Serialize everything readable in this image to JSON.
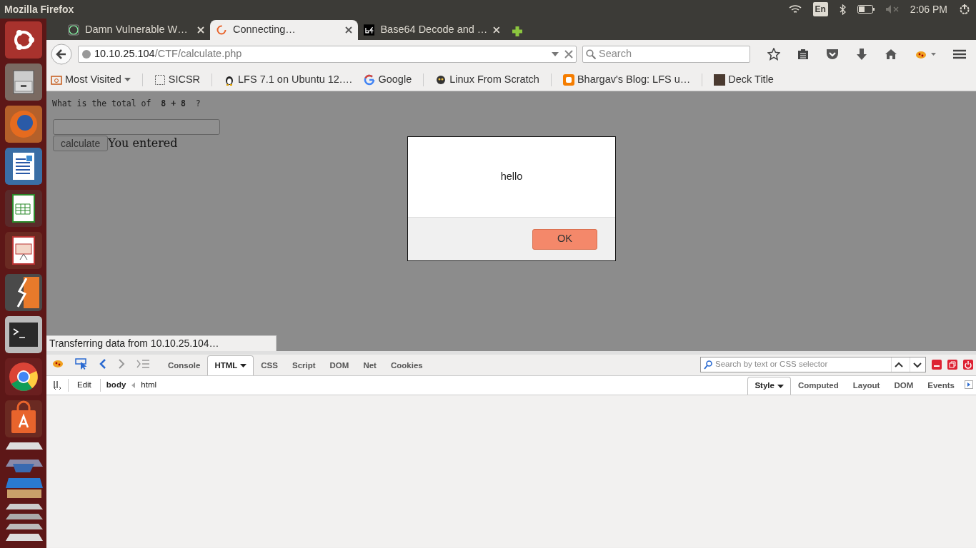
{
  "top_panel": {
    "title": "Mozilla Firefox",
    "keyboard_layout": "En",
    "clock": "2:06 PM"
  },
  "tabs": [
    {
      "label": "Damn Vulnerable W…",
      "selected": false
    },
    {
      "label": "Connecting…",
      "selected": true
    },
    {
      "label": "Base64 Decode and …",
      "selected": false
    }
  ],
  "address": {
    "host": "10.10.25.104",
    "path": "/CTF/calculate.php"
  },
  "search": {
    "placeholder": "Search"
  },
  "bookmarks": [
    {
      "label": "Most Visited",
      "kind": "folder"
    },
    {
      "label": "SICSR",
      "kind": "blank"
    },
    {
      "label": "LFS 7.1 on Ubuntu 12.…",
      "kind": "penguin"
    },
    {
      "label": "Google",
      "kind": "google"
    },
    {
      "label": "Linux From Scratch",
      "kind": "mascot"
    },
    {
      "label": "Bhargav's Blog: LFS u…",
      "kind": "blog"
    },
    {
      "label": "Deck Title",
      "kind": "photo"
    }
  ],
  "page": {
    "question": "What is the total of  **8 + 8**  ?",
    "button": "calculate",
    "result": "You entered"
  },
  "dialog": {
    "message": "hello",
    "button": "OK"
  },
  "status": "Transferring data from 10.10.25.104…",
  "devtools": {
    "panels": [
      {
        "label": "Console",
        "selected": false
      },
      {
        "label": "HTML",
        "selected": true
      },
      {
        "label": "CSS",
        "selected": false
      },
      {
        "label": "Script",
        "selected": false
      },
      {
        "label": "DOM",
        "selected": false
      },
      {
        "label": "Net",
        "selected": false
      },
      {
        "label": "Cookies",
        "selected": false
      }
    ],
    "search_placeholder": "Search by text or CSS selector",
    "edit": "Edit",
    "breadcrumbs": [
      {
        "label": "body",
        "selected": true
      },
      {
        "label": "html",
        "selected": false
      }
    ],
    "side_tabs": [
      {
        "label": "Style",
        "selected": true
      },
      {
        "label": "Computed",
        "selected": false
      },
      {
        "label": "Layout",
        "selected": false
      },
      {
        "label": "DOM",
        "selected": false
      },
      {
        "label": "Events",
        "selected": false
      }
    ]
  }
}
